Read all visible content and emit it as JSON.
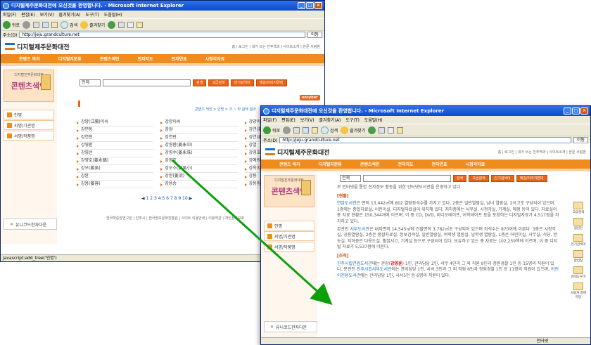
{
  "browser": {
    "title": "디지털제주문화대전에 오신것을 환영합니다. - Microsoft Internet Explorer",
    "menu": [
      "파일(F)",
      "편집(E)",
      "보기(V)",
      "즐겨찾기(A)",
      "도구(T)",
      "도움말(H)"
    ],
    "toolbar": {
      "back": "뒤로",
      "search": "검색",
      "favorites": "즐겨찾기"
    },
    "address_label": "주소(D)",
    "address": "http://jeju.grandculture.net",
    "go": "이동"
  },
  "site": {
    "logo": "디지털제주문화대전",
    "toplinks": "홈 | 로그인 | 내가 쓰는 진주백과 | 사이트소개 | 한문 서림판",
    "nav": [
      "콘텐츠 목차",
      "디지털지분류",
      "콘텐츠색인",
      "전자지도",
      "전자연표",
      "시청각자료"
    ],
    "banner_sub": "디지털진주문화대전",
    "banner_main": "콘텐츠색인",
    "side_menu": [
      "인명",
      "지명/기관명",
      "서명/작품명"
    ],
    "side_bottom": "유니코드한자다운",
    "search": {
      "select": "전체",
      "btn_search": "검색",
      "btn_adv": "고급검색",
      "btn_pop": "인기검색어",
      "btn_alias": "태깅/이미지연대"
    },
    "encyc_badge": "encyber",
    "breadcrumb": "콘텐츠 색인 > 인명 > 가 ~ 하 검색 결과"
  },
  "index_list": [
    "강양(江陽)이씨",
    "강양이씨",
    "강양이씨(江陽李氏)",
    "강연동",
    "강업",
    "강연(姜郴)",
    "강연천",
    "강연란",
    "강연(姜郴)부인",
    "강영환",
    "강영환(姜永中)",
    "강열",
    "강영선",
    "강영수(姜永洙)",
    "강영호",
    "강영호(姜永鎬)",
    "강영호",
    "강예원",
    "강오(姜吳)",
    "강오소(姜吳小)",
    "강옥희",
    "강완",
    "강완(姜浣)",
    "강용",
    "강용(姜容)",
    "강용승",
    "강용림"
  ],
  "pager": {
    "pages": "◀ 1 2 3 4 5 6 7 8 9 10 ▶",
    "current": "1"
  },
  "footer": "한국학중앙연구원 | 진주시 | 한국정보문화진흥원 | 사이트 이용안내 | 이용약관 | 개인정보보호",
  "status1": "javascript:add_tree('인명')",
  "status2": "인터넷",
  "article": {
    "intro": "로 인터넷을 통한 전자정보 활동을 위한 인터넷도서관을 운영하고 있다.",
    "h1": "[현황]",
    "p1a": "연암도서관",
    "p1b": "은 면적 13,442㎡에 802 열람좌석수를 가지고 있다. 2층은 일반열람실, 남녀 열람실, 2석고로 구성되어 있으며, 1층에는 종합자료실, 어린이실, 디지털자료실이 위치해 있다. 지하층에는 사무실, 시청각실, 기계실, 매점 등이 있다. 자료실의 총 자료 현황은 150,344개에 이르며, 이 중 CD, DVD, 비디오테이프, 어학테이프 등을 포함하는 디지털자료가 4,517점을 차지하고 있다.",
    "p2a": "본관인 ",
    "p2b": "서부도서관",
    "p2c": "은 대지면적 14,545㎡에 건물면적 3,782㎡로 구성되어 있으며 좌석수는 870여에 이른다. 3층은 시청각실, 공용열람실, 2층은 종합자료실, 정보검색실, 일반열람실, 여학생 열람실, 남학생 열람실, 1층은 어린이실, 사무실, 식당, 방송실, 지하층은 다용도실, 휠집서고, 기계실 등으로 구성되어 있다. 보유하고 있는 총 자료는 102,259책에 이르며, 이 중 디지털 자료가 5,537점에 이른다.",
    "h2": "[조직]",
    "p3a": "진주시립연암도서관",
    "p3b": "에는 관장(",
    "p3c": "강영훈",
    "p3d": ") 1인, 관리담당 2인, 서무 4인과 그 외 직원 9인과 청원경찰 1인 등 15명의 직원이 있다. 분관인 ",
    "p3e": "진주시립서부도서관",
    "p3f": "에는 관리담당 1인, 사서 3인과 그 외 직원 6인과 청원경찰 1인 등 11명의 직원이 있으며, ",
    "p3g": "어린이전용도서관",
    "p3h": "에는 관리담당 1인, 사서5인 등 6명의 직원이 있다."
  },
  "quick_menu": [
    "고급검색",
    "집현전",
    "인기검색어",
    "팝업창",
    "검색도우미",
    "사용자 참여마당"
  ]
}
